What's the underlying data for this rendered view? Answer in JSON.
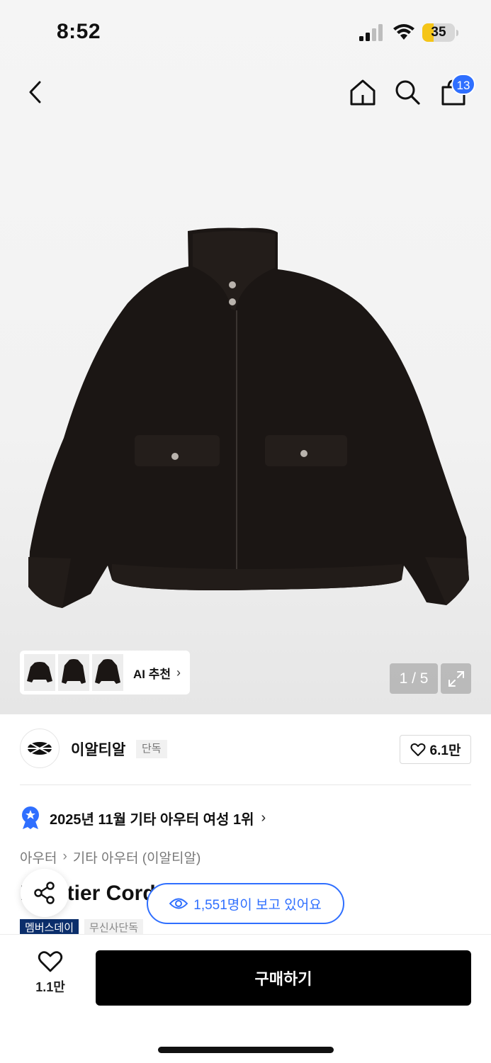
{
  "status_bar": {
    "time": "8:52",
    "battery_level": "35",
    "battery_percent": 35
  },
  "nav": {
    "cart_count": "13"
  },
  "gallery": {
    "ai_recommend_label": "AI 추천",
    "page_counter": "1 / 5"
  },
  "brand": {
    "name": "이알티알",
    "exclusive_label": "단독",
    "like_count": "6.1만"
  },
  "ranking": {
    "text": "2025년 11월 기타 아우터 여성 1위"
  },
  "breadcrumb": {
    "category": "아우터",
    "subcategory": "기타 아우터 (이알티알)"
  },
  "product": {
    "title": "Frontier Corduroy Jacket Black"
  },
  "viewers": {
    "text": "1,551명이 보고 있어요"
  },
  "tags": {
    "member_day": "멤버스데이",
    "musinsa_exclusive": "무신사단독"
  },
  "bottom_bar": {
    "wish_count": "1.1만",
    "buy_label": "구매하기"
  },
  "colors": {
    "accent_blue": "#2f6fff",
    "buy_button": "#000000",
    "member_tag": "#0b2e6b",
    "battery_fill": "#f5c518"
  },
  "icons": [
    "chevron-left-icon",
    "home-icon",
    "search-icon",
    "shopping-bag-icon",
    "expand-icon",
    "heart-icon",
    "ranking-medal-icon",
    "share-icon",
    "eye-icon",
    "brand-logo"
  ]
}
